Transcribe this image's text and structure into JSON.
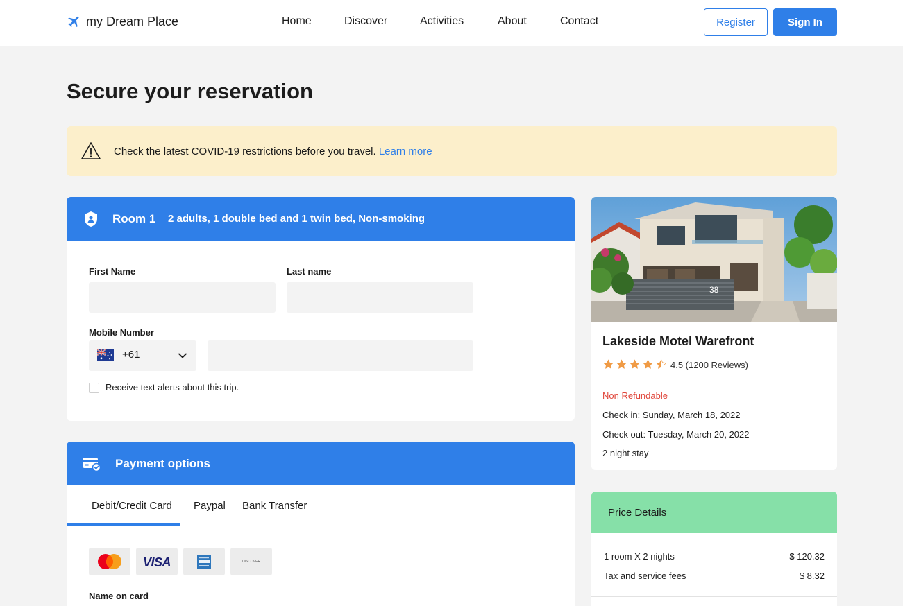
{
  "header": {
    "logo_text": "my Dream Place",
    "nav": [
      {
        "label": "Home"
      },
      {
        "label": "Discover"
      },
      {
        "label": "Activities"
      },
      {
        "label": "About"
      },
      {
        "label": "Contact"
      }
    ],
    "register_label": "Register",
    "signin_label": "Sign In"
  },
  "page": {
    "title": "Secure your reservation"
  },
  "alert": {
    "text": "Check the latest COVID-19 restrictions before you travel.",
    "link": "Learn more"
  },
  "room": {
    "title": "Room 1",
    "description": "2 adults, 1 double bed and 1 twin bed, Non-smoking",
    "first_name_label": "First Name",
    "first_name_value": "",
    "last_name_label": "Last name",
    "last_name_value": "",
    "mobile_label": "Mobile Number",
    "country_code": "+61",
    "mobile_value": "",
    "alerts_checkbox_label": "Receive text alerts about this trip.",
    "alerts_checked": false
  },
  "payment": {
    "title": "Payment options",
    "tabs": [
      {
        "label": "Debit/Credit Card",
        "active": true
      },
      {
        "label": "Paypal",
        "active": false
      },
      {
        "label": "Bank Transfer",
        "active": false
      }
    ],
    "card_logos": [
      "mastercard-icon",
      "visa-icon",
      "amex-icon",
      "discover-icon"
    ],
    "visa_text": "VISA",
    "discover_text": "DISCOVER",
    "name_on_card_label": "Name on card"
  },
  "hotel": {
    "name": "Lakeside Motel Warefront",
    "rating": 4.5,
    "rating_text": "4.5 (1200 Reviews)",
    "house_number": "38",
    "refund_policy": "Non Refundable",
    "check_in": "Check in: Sunday, March 18, 2022",
    "check_out": "Check out: Tuesday, March 20, 2022",
    "stay": "2 night stay"
  },
  "price": {
    "title": "Price Details",
    "rows": [
      {
        "label": "1 room X 2 nights",
        "amount": "$ 120.32"
      },
      {
        "label": "Tax and service fees",
        "amount": "$ 8.32"
      }
    ]
  },
  "colors": {
    "primary": "#2f7fe8",
    "alert_bg": "#fcefcb",
    "price_header": "#86e0a8",
    "star": "#f09b45",
    "refund": "#e0453a"
  }
}
